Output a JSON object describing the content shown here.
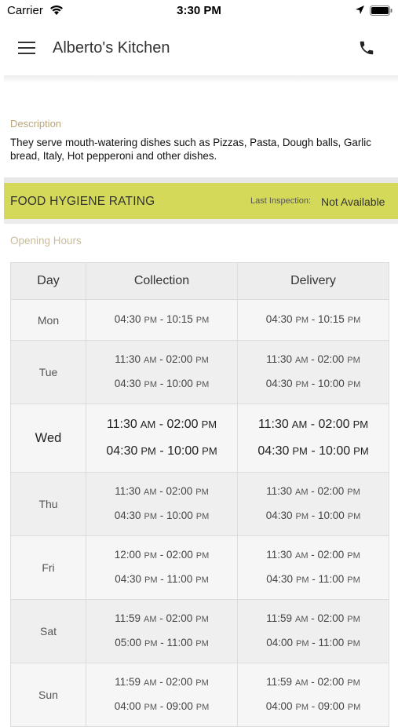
{
  "status_bar": {
    "carrier": "Carrier",
    "time": "3:30 PM"
  },
  "header": {
    "title": "Alberto's Kitchen"
  },
  "description": {
    "label": "Description",
    "text": "They serve mouth-watering dishes such as Pizzas, Pasta, Dough balls, Garlic bread, Italy, Hot pepperoni and other dishes."
  },
  "hygiene": {
    "title": "FOOD HYGIENE RATING",
    "last_inspection_label": "Last Inspection:",
    "last_inspection_value": "Not Available",
    "color": "#d5d95a"
  },
  "opening_hours": {
    "label": "Opening Hours",
    "headers": [
      "Day",
      "Collection",
      "Delivery"
    ],
    "rows": [
      {
        "day": "Mon",
        "collection": [
          {
            "time": "04:30",
            "ap": "PM",
            "time2": "10:15",
            "ap2": "PM"
          }
        ],
        "delivery": [
          {
            "time": "04:30",
            "ap": "PM",
            "time2": "10:15",
            "ap2": "PM"
          }
        ]
      },
      {
        "day": "Tue",
        "collection": [
          {
            "time": "11:30",
            "ap": "AM",
            "time2": "02:00",
            "ap2": "PM"
          },
          {
            "time": "04:30",
            "ap": "PM",
            "time2": "10:00",
            "ap2": "PM"
          }
        ],
        "delivery": [
          {
            "time": "11:30",
            "ap": "AM",
            "time2": "02:00",
            "ap2": "PM"
          },
          {
            "time": "04:30",
            "ap": "PM",
            "time2": "10:00",
            "ap2": "PM"
          }
        ]
      },
      {
        "day": "Wed",
        "today": true,
        "collection": [
          {
            "time": "11:30",
            "ap": "AM",
            "time2": "02:00",
            "ap2": "PM"
          },
          {
            "time": "04:30",
            "ap": "PM",
            "time2": "10:00",
            "ap2": "PM"
          }
        ],
        "delivery": [
          {
            "time": "11:30",
            "ap": "AM",
            "time2": "02:00",
            "ap2": "PM"
          },
          {
            "time": "04:30",
            "ap": "PM",
            "time2": "10:00",
            "ap2": "PM"
          }
        ]
      },
      {
        "day": "Thu",
        "collection": [
          {
            "time": "11:30",
            "ap": "AM",
            "time2": "02:00",
            "ap2": "PM"
          },
          {
            "time": "04:30",
            "ap": "PM",
            "time2": "10:00",
            "ap2": "PM"
          }
        ],
        "delivery": [
          {
            "time": "11:30",
            "ap": "AM",
            "time2": "02:00",
            "ap2": "PM"
          },
          {
            "time": "04:30",
            "ap": "PM",
            "time2": "10:00",
            "ap2": "PM"
          }
        ]
      },
      {
        "day": "Fri",
        "collection": [
          {
            "time": "12:00",
            "ap": "PM",
            "time2": "02:00",
            "ap2": "PM"
          },
          {
            "time": "04:30",
            "ap": "PM",
            "time2": "11:00",
            "ap2": "PM"
          }
        ],
        "delivery": [
          {
            "time": "11:30",
            "ap": "AM",
            "time2": "02:00",
            "ap2": "PM"
          },
          {
            "time": "04:30",
            "ap": "PM",
            "time2": "11:00",
            "ap2": "PM"
          }
        ]
      },
      {
        "day": "Sat",
        "collection": [
          {
            "time": "11:59",
            "ap": "AM",
            "time2": "02:00",
            "ap2": "PM"
          },
          {
            "time": "05:00",
            "ap": "PM",
            "time2": "11:00",
            "ap2": "PM"
          }
        ],
        "delivery": [
          {
            "time": "11:59",
            "ap": "AM",
            "time2": "02:00",
            "ap2": "PM"
          },
          {
            "time": "04:00",
            "ap": "PM",
            "time2": "11:00",
            "ap2": "PM"
          }
        ]
      },
      {
        "day": "Sun",
        "collection": [
          {
            "time": "11:59",
            "ap": "AM",
            "time2": "02:00",
            "ap2": "PM"
          },
          {
            "time": "04:00",
            "ap": "PM",
            "time2": "09:00",
            "ap2": "PM"
          }
        ],
        "delivery": [
          {
            "time": "11:59",
            "ap": "AM",
            "time2": "02:00",
            "ap2": "PM"
          },
          {
            "time": "04:00",
            "ap": "PM",
            "time2": "09:00",
            "ap2": "PM"
          }
        ]
      }
    ]
  },
  "icons": {
    "wifi": "wifi-icon",
    "location": "location-arrow-icon",
    "battery": "battery-icon",
    "menu": "hamburger-menu-icon",
    "phone": "phone-icon"
  },
  "colors": {
    "accent_label": "#b8a57a",
    "hygiene_bar": "#d5d95a"
  }
}
